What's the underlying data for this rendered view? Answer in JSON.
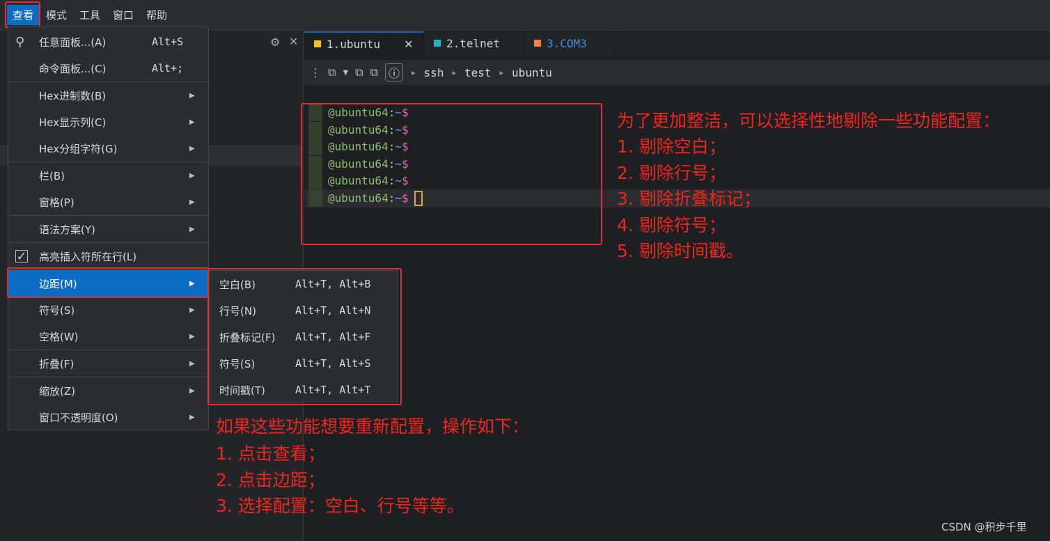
{
  "menubar": [
    "查看",
    "模式",
    "工具",
    "窗口",
    "帮助"
  ],
  "tabs": [
    {
      "label": "1.ubuntu",
      "color": "#f5c518",
      "close": "✕"
    },
    {
      "label": "2.telnet",
      "color": "#1fb5c4"
    },
    {
      "label": "3.COM3",
      "color": "#ff7a45",
      "label_color": "#3a8ee6"
    }
  ],
  "toolbar": {
    "breadcrumbs": [
      "ssh",
      "test",
      "ubuntu"
    ],
    "info_icon": "ⓘ"
  },
  "terminal": {
    "user": "@ubuntu64",
    "colon": ":",
    "path": "~",
    "dollar": "$",
    "line_count": 6
  },
  "view_menu": {
    "items": [
      {
        "icon": "search-icon",
        "label": "任意面板...(A)",
        "shortcut": "Alt+S"
      },
      {
        "label": "命令面板...(C)",
        "shortcut": "Alt+;"
      },
      {
        "label": "Hex进制数(B)",
        "submenu": true
      },
      {
        "label": "Hex显示列(C)",
        "submenu": true
      },
      {
        "label": "Hex分组字符(G)",
        "submenu": true
      },
      {
        "label": "栏(B)",
        "submenu": true
      },
      {
        "label": "窗格(P)",
        "submenu": true
      },
      {
        "label": "语法方案(Y)",
        "submenu": true
      },
      {
        "label": "高亮插入符所在行(L)",
        "checked": true
      },
      {
        "label": "边距(M)",
        "submenu": true,
        "selected": true
      },
      {
        "label": "符号(S)",
        "submenu": true
      },
      {
        "label": "空格(W)",
        "submenu": true
      },
      {
        "label": "折叠(F)",
        "submenu": true
      },
      {
        "label": "缩放(Z)",
        "submenu": true
      },
      {
        "label": "窗口不透明度(O)",
        "submenu": true
      }
    ]
  },
  "margin_submenu": [
    {
      "label": "空白(B)",
      "shortcut": "Alt+T, Alt+B"
    },
    {
      "label": "行号(N)",
      "shortcut": "Alt+T, Alt+N"
    },
    {
      "label": "折叠标记(F)",
      "shortcut": "Alt+T, Alt+F"
    },
    {
      "label": "符号(S)",
      "shortcut": "Alt+T, Alt+S"
    },
    {
      "label": "时间戳(T)",
      "shortcut": "Alt+T, Alt+T"
    }
  ],
  "annotation_right": [
    "为了更加整洁，可以选择性地剔除一些功能配置：",
    "1. 剔除空白；",
    "2. 剔除行号；",
    "3. 剔除折叠标记；",
    "4. 剔除符号；",
    "5. 剔除时间戳。"
  ],
  "annotation_bottom": [
    "如果这些功能想要重新配置，操作如下：",
    "1. 点击查看；",
    "2. 点击边距；",
    "3. 选择配置：空白、行号等等。"
  ],
  "watermark": "CSDN @积步千里",
  "colors": {
    "accent": "#0a6cc2",
    "annotation": "#f0261d"
  }
}
